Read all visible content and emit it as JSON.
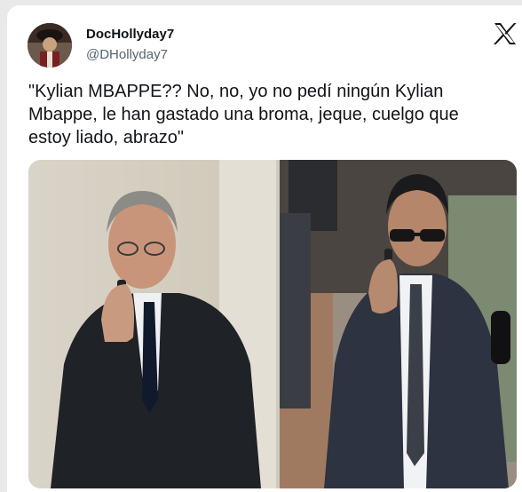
{
  "author": {
    "display_name": "DocHollyday7",
    "handle": "@DHollyday7",
    "avatar_icon": "profile-avatar"
  },
  "platform": {
    "logo_icon": "x-logo-icon"
  },
  "tweet": {
    "text": "\"Kylian MBAPPE?? No, no, yo no pedí ningún Kylian\nMbappe, le han gastado una broma, jeque, cuelgo que\nestoy liado, abrazo\""
  },
  "media": {
    "left_photo": "man-in-dark-suit-on-phone",
    "right_photo": "man-with-sunglasses-on-phone"
  },
  "colors": {
    "background": "#e9e9e9",
    "card": "#ffffff",
    "text": "#0f1419",
    "secondary_text": "#536471"
  }
}
